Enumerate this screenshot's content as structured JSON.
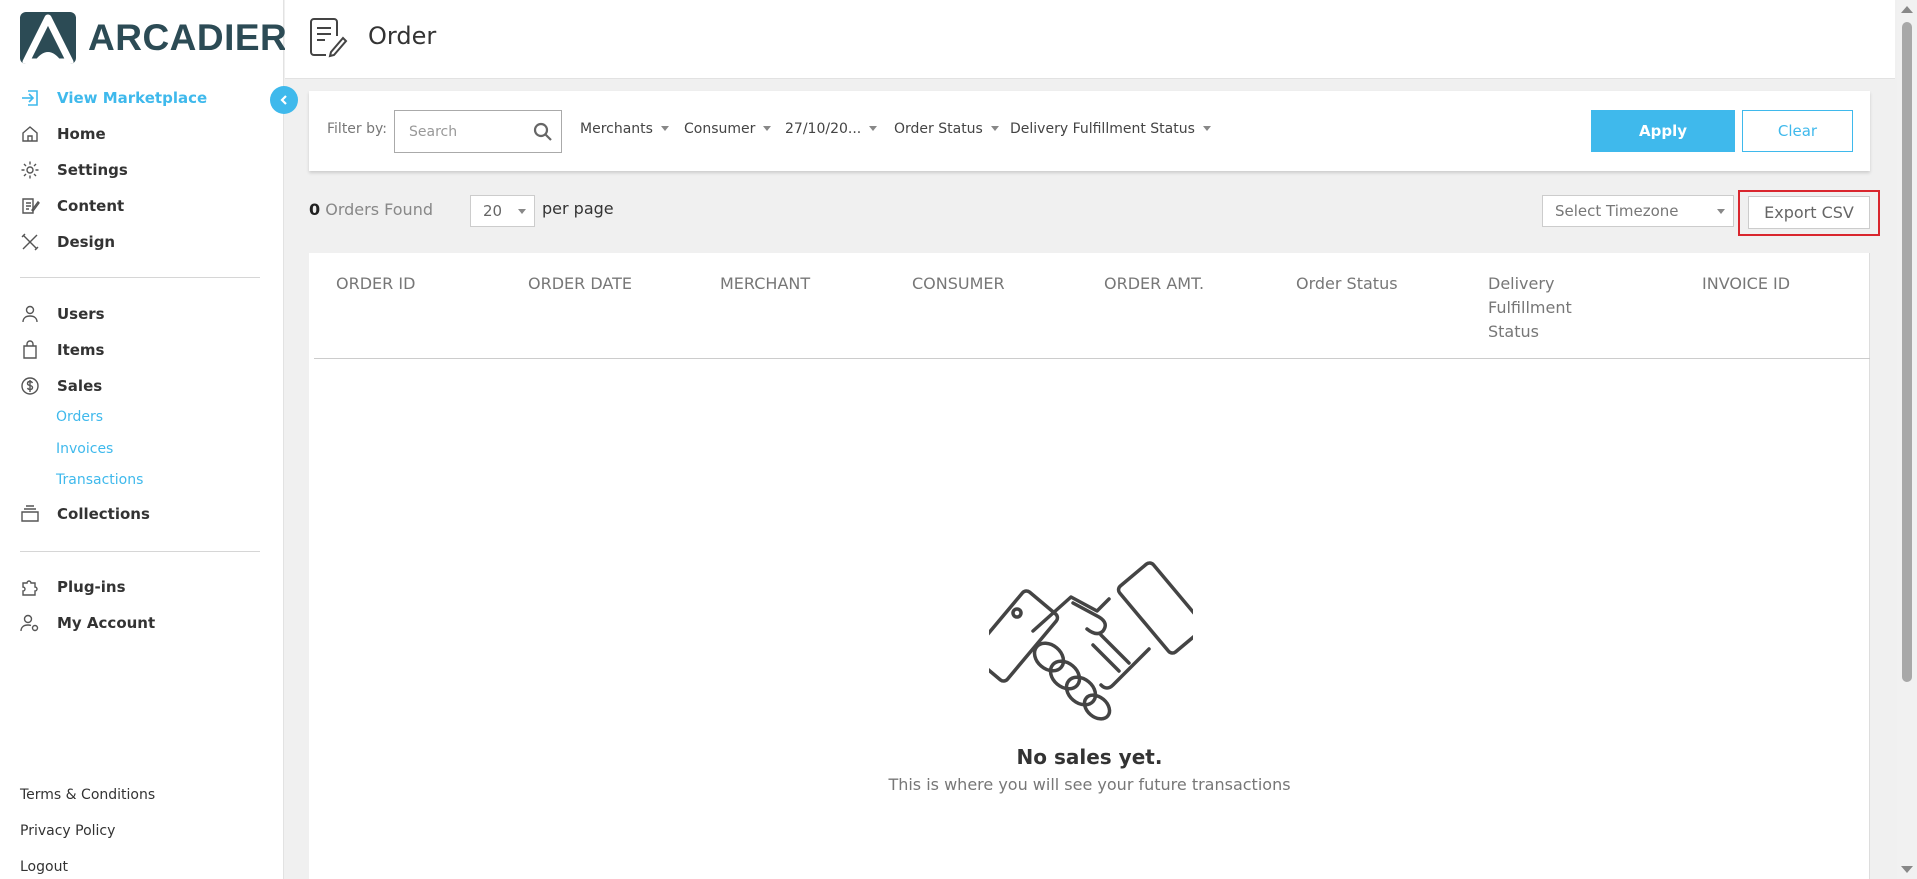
{
  "brand": {
    "name": "ARCADIER",
    "color": "#2c4b55",
    "accent": "#3fb9ec"
  },
  "header": {
    "title": "Order"
  },
  "sidebar": {
    "view_marketplace": "View Marketplace",
    "main_items": [
      {
        "label": "Home",
        "icon": "home-icon"
      },
      {
        "label": "Settings",
        "icon": "gear-icon"
      },
      {
        "label": "Content",
        "icon": "content-edit-icon"
      },
      {
        "label": "Design",
        "icon": "design-tools-icon"
      }
    ],
    "manage_items": [
      {
        "label": "Users",
        "icon": "user-icon"
      },
      {
        "label": "Items",
        "icon": "shopping-bag-icon"
      },
      {
        "label": "Sales",
        "icon": "dollar-icon"
      }
    ],
    "sales_sub": [
      "Orders",
      "Invoices",
      "Transactions"
    ],
    "collections": "Collections",
    "extra_items": [
      {
        "label": "Plug-ins",
        "icon": "puzzle-icon"
      },
      {
        "label": "My Account",
        "icon": "account-settings-icon"
      }
    ],
    "footer": [
      "Terms & Conditions",
      "Privacy Policy",
      "Logout"
    ]
  },
  "filters": {
    "label": "Filter by:",
    "search_placeholder": "Search",
    "merchants": "Merchants",
    "consumer": "Consumer",
    "date": "27/10/20...",
    "order_status": "Order Status",
    "delivery_status": "Delivery Fulfillment Status",
    "apply": "Apply",
    "clear": "Clear"
  },
  "toolbar": {
    "orders_count": "0",
    "orders_found": "Orders Found",
    "per_page_value": "20",
    "per_page_label": "per page",
    "timezone_placeholder": "Select Timezone",
    "export_label": "Export CSV"
  },
  "table": {
    "columns": [
      "ORDER ID",
      "ORDER DATE",
      "MERCHANT",
      "CONSUMER",
      "ORDER AMT.",
      "Order Status",
      "Delivery Fulfillment Status",
      "INVOICE ID"
    ],
    "rows": []
  },
  "empty_state": {
    "title": "No sales yet.",
    "subtitle": "This is where you will see your future transactions",
    "icon": "handshake-icon"
  }
}
